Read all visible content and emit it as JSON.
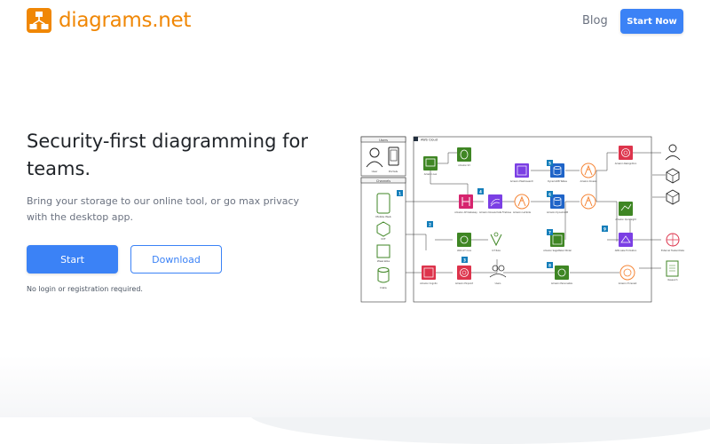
{
  "header": {
    "logo_text": "diagrams.net",
    "logo_icon": "diagram-logo-icon",
    "nav_blog": "Blog",
    "start_now": "Start Now"
  },
  "hero": {
    "title": "Security-first diagramming for teams.",
    "subtitle": "Bring your storage to our online tool, or go max privacy with the desktop app.",
    "start": "Start",
    "download": "Download",
    "note": "No login or registration required."
  },
  "diagram": {
    "users_header": "Users",
    "channels_header": "Channels",
    "cloud_label": "AWS Cloud",
    "users": [
      "User",
      "Portals"
    ],
    "channels": [
      "Mobile Web",
      "IOT",
      "Wearable",
      "Data"
    ],
    "step_badges": [
      "1",
      "2",
      "3",
      "4",
      "5",
      "6",
      "7",
      "8",
      "9"
    ],
    "node_labels": [
      "Amazon Lex",
      "Amazon S3",
      "Amazon API Gateway",
      "Amazon Kinesis Data Firehose",
      "Amazon Cognito",
      "AWS IoT Core",
      "IoT Rule",
      "Amazon Pinpoint",
      "Users",
      "Amazon Elasticsearch",
      "DynamoDB Tables",
      "Amazon DynamoDB",
      "Amazon Lambda",
      "Amazon Kinesis",
      "Amazon SageMaker Model",
      "Amazon Rekognition",
      "Amazon Personalize",
      "Amazon QuickSight",
      "AWS Lake Formation",
      "Amazon Comprehend",
      "Amazon SageMaker",
      "Amazon Kendra",
      "Amazon Athena",
      "Amazon Redshift",
      "Amazon Forecast",
      "External Trusted Data",
      "Research"
    ],
    "colors": {
      "orange": "#f58536",
      "pink": "#d6246e",
      "green": "#3f8624",
      "purple": "#7b3fe4",
      "blue": "#1f64c8",
      "red": "#dd344c",
      "badge": "#147eba"
    }
  }
}
